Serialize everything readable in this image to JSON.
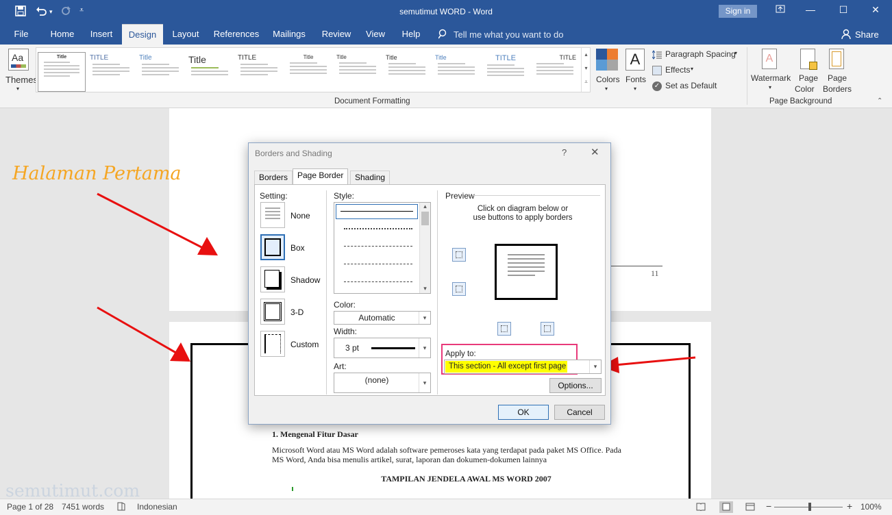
{
  "window": {
    "title": "semutimut WORD  -  Word",
    "signin": "Sign in"
  },
  "tabs": [
    "File",
    "Home",
    "Insert",
    "Design",
    "Layout",
    "References",
    "Mailings",
    "Review",
    "View",
    "Help"
  ],
  "active_tab": "Design",
  "tellme": "Tell me what you want to do",
  "share": "Share",
  "ribbon": {
    "themes": "Themes",
    "gallery_titles": [
      "Title",
      "TITLE",
      "Title",
      "Title",
      "TITLE",
      "Title",
      "Title",
      "Title",
      "Title",
      "TITLE",
      "TITLE"
    ],
    "colors": "Colors",
    "fonts": "Fonts",
    "paragraph_spacing": "Paragraph Spacing",
    "effects": "Effects",
    "set_default": "Set as Default",
    "document_formatting": "Document Formatting",
    "watermark": "Watermark",
    "page_color_1": "Page",
    "page_color_2": "Color",
    "page_borders_1": "Page",
    "page_borders_2": "Borders",
    "page_background": "Page Background"
  },
  "annotation": {
    "label": "Halaman Pertama",
    "watermark": "semutimut.com"
  },
  "document": {
    "page_number": "11",
    "heading": "1.    Mengenal Fitur Dasar",
    "para_line1": "Microsoft Word atau MS Word adalah software pemeroses kata yang terdapat pada paket MS Office. Pada",
    "para_line2": "MS Word, Anda bisa menulis artikel, surat, laporan dan dokumen-dokumen lainnya",
    "subtitle": "TAMPILAN JENDELA AWAL MS WORD 2007"
  },
  "dialog": {
    "title": "Borders and Shading",
    "help": "?",
    "tabs": [
      "Borders",
      "Page Border",
      "Shading"
    ],
    "setting_label": "Setting:",
    "settings": [
      "None",
      "Box",
      "Shadow",
      "3-D",
      "Custom"
    ],
    "style_label": "Style:",
    "color_label": "Color:",
    "color_value": "Automatic",
    "width_label": "Width:",
    "width_value": "3 pt",
    "art_label": "Art:",
    "art_value": "(none)",
    "preview_label": "Preview",
    "preview_hint_1": "Click on diagram below or",
    "preview_hint_2": "use buttons to apply borders",
    "apply_label": "Apply to:",
    "apply_value": "This section - All except first page",
    "options": "Options...",
    "ok": "OK",
    "cancel": "Cancel"
  },
  "status": {
    "page": "Page 1 of 28",
    "words": "7451 words",
    "language": "Indonesian",
    "zoom": "100%"
  },
  "colors": {
    "accent": "#2b579a",
    "annotation": "#f5a623",
    "arrow": "#e81010",
    "highlight": "#ffff00",
    "highlight_box": "#e8397a"
  }
}
